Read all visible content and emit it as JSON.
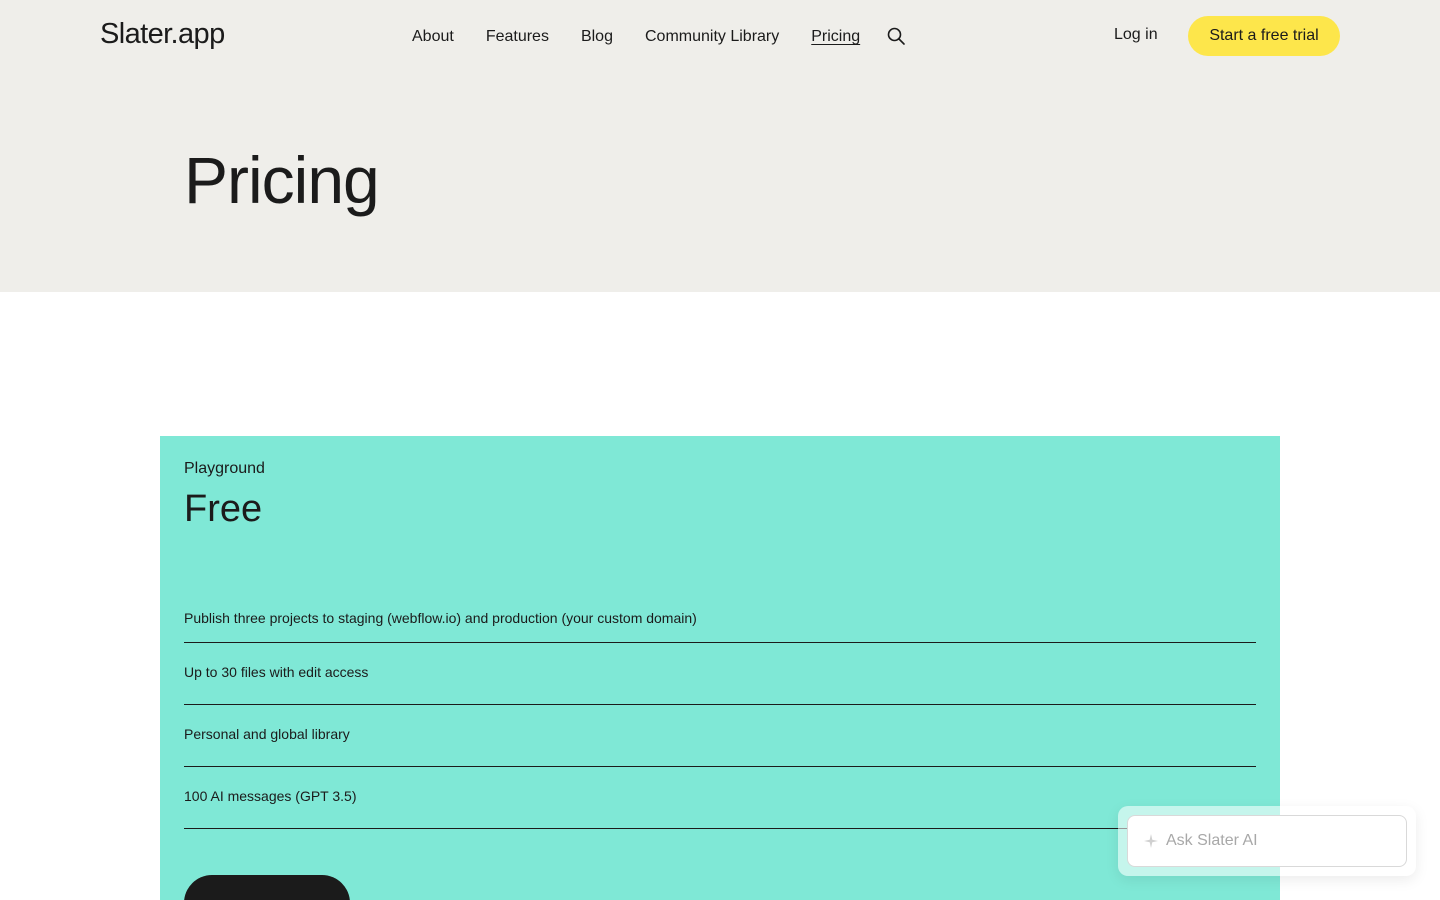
{
  "header": {
    "logo": "Slater.app",
    "nav": [
      {
        "label": "About"
      },
      {
        "label": "Features"
      },
      {
        "label": "Blog"
      },
      {
        "label": "Community Library"
      },
      {
        "label": "Pricing",
        "active": true
      }
    ],
    "login_label": "Log in",
    "cta_label": "Start a free trial",
    "cta_color": "#fde64b"
  },
  "hero": {
    "title": "Pricing",
    "background": "#efeeea"
  },
  "plan": {
    "name": "Playground",
    "price": "Free",
    "background": "#7fe8d6",
    "features": [
      "Publish three projects to staging (webflow.io) and production (your custom domain)",
      "Up to 30 files with edit access",
      "Personal and global library",
      "100 AI messages (GPT 3.5)"
    ]
  },
  "ai_widget": {
    "placeholder": "Ask Slater AI",
    "icon": "sparkle-icon"
  }
}
